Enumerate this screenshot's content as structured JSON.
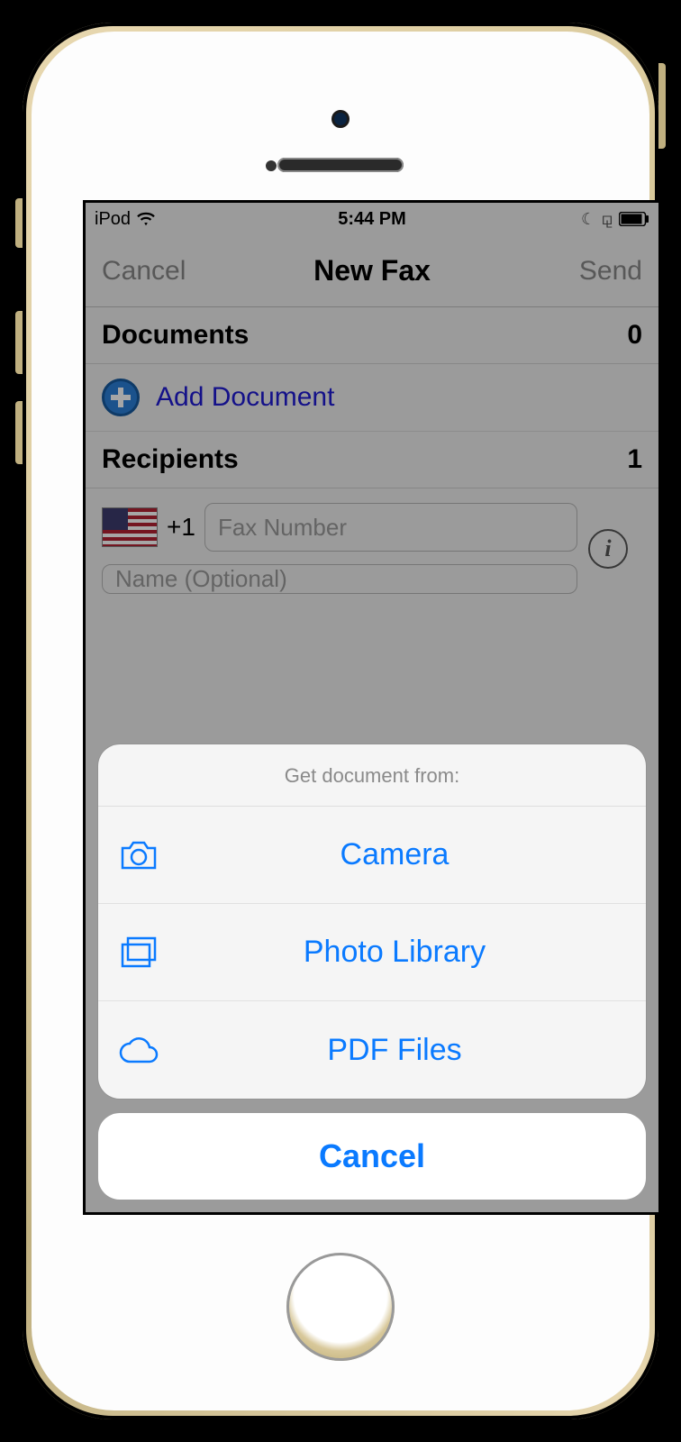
{
  "status": {
    "carrier": "iPod",
    "time": "5:44 PM"
  },
  "nav": {
    "left": "Cancel",
    "title": "New Fax",
    "right": "Send"
  },
  "documents": {
    "header": "Documents",
    "count": "0",
    "add_label": "Add Document"
  },
  "recipients": {
    "header": "Recipients",
    "count": "1",
    "dial_code": "+1",
    "fax_placeholder": "Fax Number",
    "name_placeholder": "Name (Optional)"
  },
  "sheet": {
    "title": "Get document from:",
    "items": [
      {
        "label": "Camera"
      },
      {
        "label": "Photo Library"
      },
      {
        "label": "PDF Files"
      }
    ],
    "cancel": "Cancel"
  }
}
